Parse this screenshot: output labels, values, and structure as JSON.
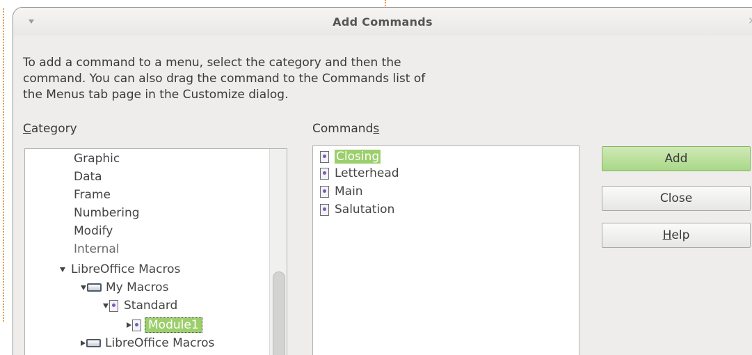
{
  "dialog": {
    "title": "Add Commands",
    "close_glyph": "×",
    "menu_glyph": "▾",
    "description_lines": [
      "To add a command to a menu, select the category and then the",
      "command. You can also drag the command to the Commands list of",
      "the Menus tab page in the Customize dialog."
    ]
  },
  "category": {
    "label_access": "C",
    "label_rest": "ategory",
    "items": [
      {
        "label": "Graphic"
      },
      {
        "label": "Data"
      },
      {
        "label": "Frame"
      },
      {
        "label": "Numbering"
      },
      {
        "label": "Modify"
      },
      {
        "label": "Internal"
      },
      {
        "label": "LibreOffice Macros"
      },
      {
        "label": "My Macros"
      },
      {
        "label": "Standard"
      },
      {
        "label": "Module1"
      },
      {
        "label": "LibreOffice Macros"
      }
    ]
  },
  "commands": {
    "label_main": "Command",
    "label_access": "s",
    "items": [
      {
        "label": "Closing"
      },
      {
        "label": "Letterhead"
      },
      {
        "label": "Main"
      },
      {
        "label": "Salutation"
      }
    ]
  },
  "buttons": {
    "add": "Add",
    "close": "Close",
    "help_access": "H",
    "help_rest": "elp"
  },
  "colors": {
    "selection": "#9ccf6c",
    "primary_button": "#b5df94",
    "dialog_background": "#eeedeb"
  },
  "icons": {
    "tree_expand": "triangle-down-icon",
    "tree_collapsed": "triangle-right-icon",
    "macro_library": "drive-icon",
    "macro_document": "macro-doc-icon"
  }
}
